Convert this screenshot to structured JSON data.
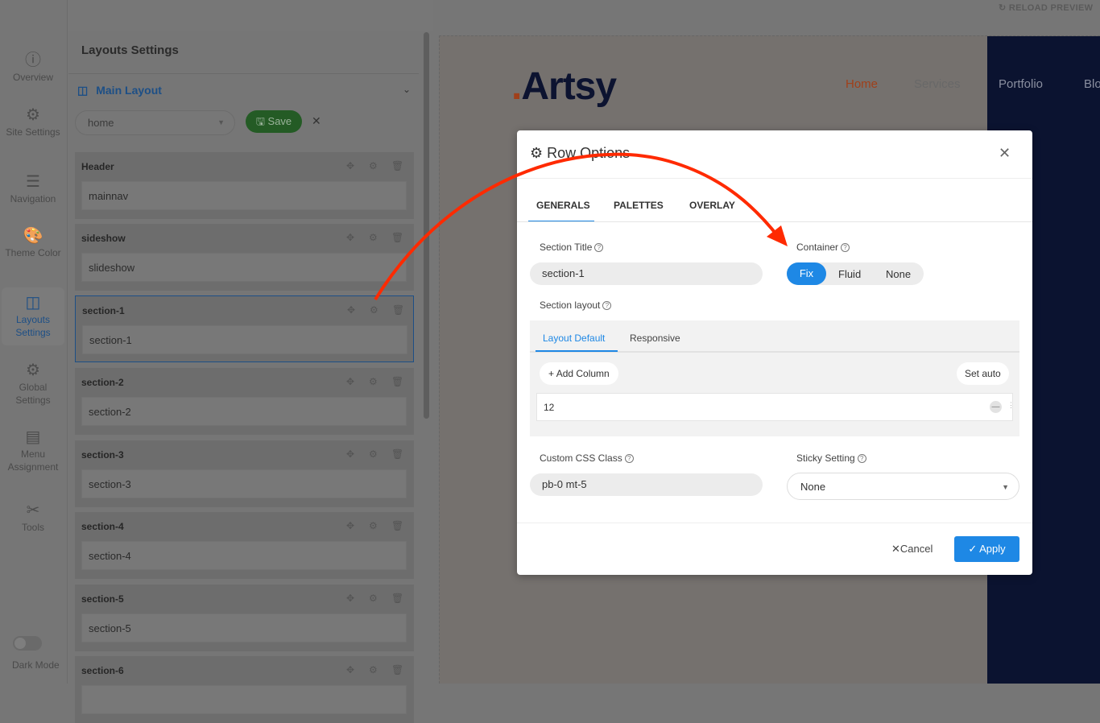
{
  "rail": {
    "items": [
      {
        "label": "Overview",
        "icon": "info-icon"
      },
      {
        "label": "Site Settings",
        "icon": "gear-icon"
      },
      {
        "label": "Navigation",
        "icon": "menu-icon"
      },
      {
        "label": "Theme Color",
        "icon": "palette-icon"
      },
      {
        "label": "Layouts Settings",
        "icon": "layout-icon"
      },
      {
        "label": "Global Settings",
        "icon": "gears-icon"
      },
      {
        "label": "Menu Assignment",
        "icon": "list-icon"
      },
      {
        "label": "Tools",
        "icon": "tools-icon"
      }
    ],
    "dark_mode": "Dark Mode"
  },
  "panel": {
    "title": "Layouts Settings",
    "main_layout": "Main Layout",
    "layout_select": "home",
    "save": "Save",
    "sections": [
      {
        "title": "Header",
        "value": "mainnav"
      },
      {
        "title": "sideshow",
        "value": "slideshow"
      },
      {
        "title": "section-1",
        "value": "section-1"
      },
      {
        "title": "section-2",
        "value": "section-2"
      },
      {
        "title": "section-3",
        "value": "section-3"
      },
      {
        "title": "section-4",
        "value": "section-4"
      },
      {
        "title": "section-5",
        "value": "section-5"
      },
      {
        "title": "section-6",
        "value": ""
      }
    ]
  },
  "preview": {
    "reload": "RELOAD PREVIEW",
    "logo": "Artsy",
    "nav": [
      "Home",
      "Services",
      "Portfolio",
      "Blo"
    ]
  },
  "modal": {
    "title": "Row Options",
    "tabs": [
      "GENERALS",
      "PALETTES",
      "OVERLAY"
    ],
    "section_title_label": "Section Title",
    "section_title": "section-1",
    "container_label": "Container",
    "container_options": [
      "Fix",
      "Fluid",
      "None"
    ],
    "container_selected": "Fix",
    "section_layout_label": "Section layout",
    "layout_tabs": [
      "Layout Default",
      "Responsive"
    ],
    "add_column": "Add Column",
    "set_auto": "Set auto",
    "column": "12",
    "css_label": "Custom CSS Class",
    "css_value": "pb-0 mt-5",
    "sticky_label": "Sticky Setting",
    "sticky_value": "None",
    "cancel": "Cancel",
    "apply": "Apply"
  },
  "colors": {
    "accent": "#1e88e5",
    "save": "#2e7d32",
    "arrow": "#ff2a00"
  }
}
